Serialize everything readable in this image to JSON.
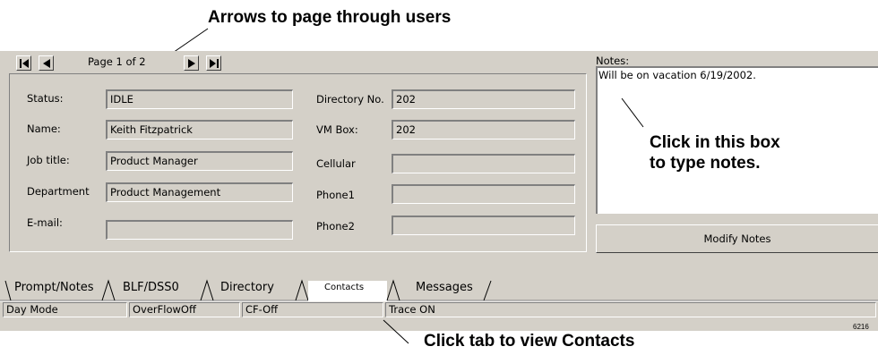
{
  "callouts": {
    "arrows": "Arrows to page through users",
    "notes": "Click in this box\nto type notes.",
    "notes_line1": "Click in this box",
    "notes_line2": "to type notes.",
    "tab": "Click tab to view Contacts"
  },
  "figure_id": "6216",
  "pager": {
    "label": "Page 1 of 2"
  },
  "notes": {
    "label": "Notes:",
    "value": "Will be on vacation 6/19/2002.",
    "modify_label": "Modify Notes"
  },
  "fields_left": [
    {
      "label": "Status:",
      "value": "IDLE"
    },
    {
      "label": "Name:",
      "value": "Keith Fitzpatrick"
    },
    {
      "label": "Job title:",
      "value": "Product Manager"
    },
    {
      "label": "Department",
      "value": "Product Management"
    },
    {
      "label": "E-mail:",
      "value": ""
    }
  ],
  "fields_right": [
    {
      "label": "Directory No.",
      "value": "202"
    },
    {
      "label": "VM Box:",
      "value": "202"
    },
    {
      "label": "Cellular",
      "value": ""
    },
    {
      "label": "Phone1",
      "value": ""
    },
    {
      "label": "Phone2",
      "value": ""
    }
  ],
  "tabs": [
    {
      "label": "Prompt/Notes"
    },
    {
      "label": "BLF/DSS0"
    },
    {
      "label": "Directory"
    },
    {
      "label": "Contacts",
      "active": true
    },
    {
      "label": "Messages"
    }
  ],
  "statusbar": [
    "Day Mode",
    "OverFlowOff",
    "CF-Off",
    "Trace ON"
  ]
}
